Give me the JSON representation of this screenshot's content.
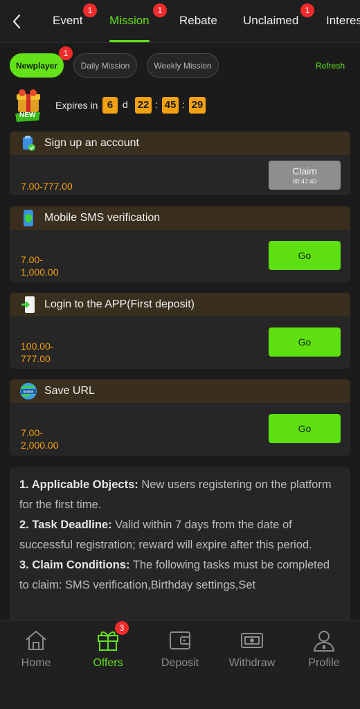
{
  "tabs": [
    {
      "label": "Event",
      "badge": "1"
    },
    {
      "label": "Mission",
      "badge": "1",
      "active": true
    },
    {
      "label": "Rebate"
    },
    {
      "label": "Unclaimed",
      "badge": "1"
    },
    {
      "label": "Interest"
    }
  ],
  "subtabs": {
    "newplayer": {
      "label": "Newplayer",
      "badge": "1"
    },
    "daily": {
      "label": "Daily Mission"
    },
    "weekly": {
      "label": "Weekly Mission"
    },
    "refresh": "Refresh"
  },
  "expiry": {
    "badge_text": "NEW",
    "label": "Expires in",
    "days": "6",
    "day_unit": "d",
    "hours": "22",
    "minutes": "45",
    "seconds": "29",
    "sep": ":"
  },
  "tasks": [
    {
      "title": "Sign up an account",
      "reward": "7.00-777.00",
      "button": "Claim",
      "timer": "00:47:40",
      "icon": "clipboard-check-icon"
    },
    {
      "title": "Mobile SMS verification",
      "reward": "7.00-1,000.00",
      "button": "Go",
      "icon": "phone-shield-icon"
    },
    {
      "title": "Login to the APP(First deposit)",
      "reward": "100.00-777.00",
      "button": "Go",
      "icon": "app-login-icon"
    },
    {
      "title": "Save URL",
      "reward": "7.00-2,000.00",
      "button": "Go",
      "icon": "www-globe-icon"
    }
  ],
  "rules": [
    {
      "head": "1. Applicable Objects:",
      "text": " New users registering on the platform for the first time."
    },
    {
      "head": "2. Task Deadline:",
      "text": " Valid within 7 days from the date of successful registration; reward will expire after this period."
    },
    {
      "head": "3. Claim Conditions:",
      "text": " The following tasks must be completed to claim: SMS verification,Birthday settings,Set"
    }
  ],
  "nav": [
    {
      "label": "Home",
      "icon": "home-icon"
    },
    {
      "label": "Offers",
      "icon": "gift-icon",
      "badge": "3",
      "active": true
    },
    {
      "label": "Deposit",
      "icon": "wallet-icon"
    },
    {
      "label": "Withdraw",
      "icon": "cash-icon"
    },
    {
      "label": "Profile",
      "icon": "user-icon"
    }
  ],
  "colors": {
    "accent": "#63e21a",
    "orange": "#f2a113",
    "badge": "#ef2b2b"
  }
}
